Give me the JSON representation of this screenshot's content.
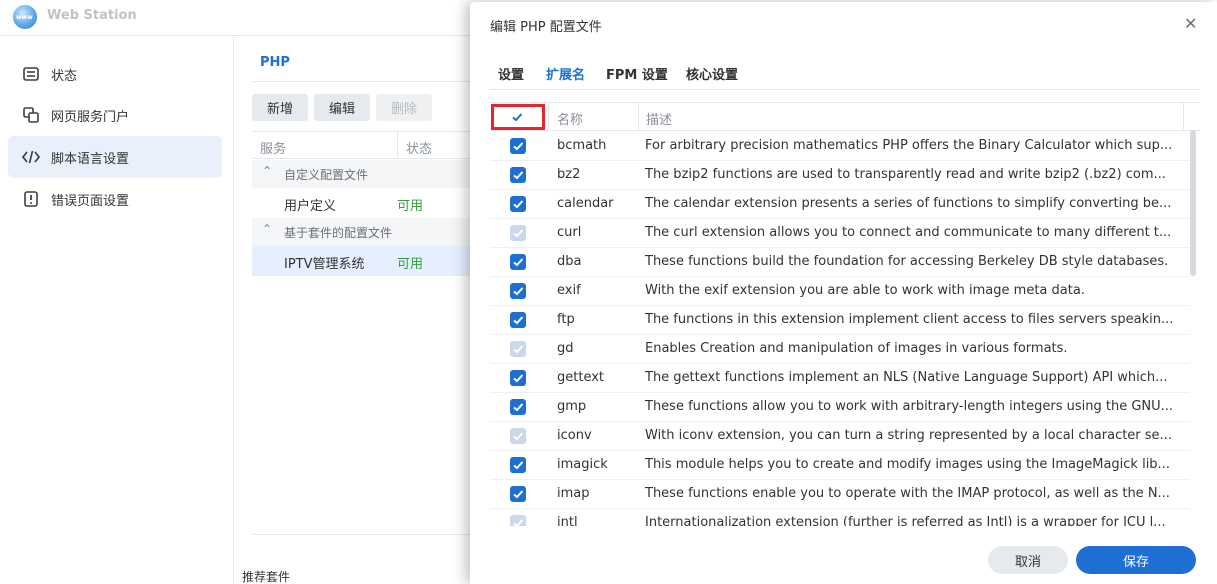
{
  "app": {
    "title": "Web Station",
    "logo_text": "www"
  },
  "sidebar": {
    "items": [
      {
        "label": "状态",
        "icon": "list-icon"
      },
      {
        "label": "网页服务门户",
        "icon": "portal-icon"
      },
      {
        "label": "脚本语言设置",
        "icon": "code-icon"
      },
      {
        "label": "错误页面设置",
        "icon": "error-page-icon"
      }
    ]
  },
  "content": {
    "tab": "PHP",
    "buttons": {
      "add": "新增",
      "edit": "编辑",
      "delete": "删除"
    },
    "columns": {
      "service": "服务",
      "status": "状态"
    },
    "groups": [
      {
        "label": "自定义配置文件",
        "rows": [
          {
            "name": "用户定义",
            "status": "可用"
          }
        ]
      },
      {
        "label": "基于套件的配置文件",
        "rows": [
          {
            "name": "IPTV管理系统",
            "status": "可用"
          }
        ]
      }
    ],
    "bottom_text": "推荐套件"
  },
  "modal": {
    "title": "编辑 PHP 配置文件",
    "tabs": [
      "设置",
      "扩展名",
      "FPM 设置",
      "核心设置"
    ],
    "active_tab": "扩展名",
    "columns": {
      "name": "名称",
      "description": "描述"
    },
    "extensions": [
      {
        "name": "bcmath",
        "desc": "For arbitrary precision mathematics PHP offers the Binary Calculator which sup...",
        "checked": true,
        "disabled": false
      },
      {
        "name": "bz2",
        "desc": "The bzip2 functions are used to transparently read and write bzip2 (.bz2) com...",
        "checked": true,
        "disabled": false
      },
      {
        "name": "calendar",
        "desc": "The calendar extension presents a series of functions to simplify converting be...",
        "checked": true,
        "disabled": false
      },
      {
        "name": "curl",
        "desc": "The curl extension allows you to connect and communicate to many different t...",
        "checked": true,
        "disabled": true
      },
      {
        "name": "dba",
        "desc": "These functions build the foundation for accessing Berkeley DB style databases.",
        "checked": true,
        "disabled": false
      },
      {
        "name": "exif",
        "desc": "With the exif extension you are able to work with image meta data.",
        "checked": true,
        "disabled": false
      },
      {
        "name": "ftp",
        "desc": "The functions in this extension implement client access to files servers speakin...",
        "checked": true,
        "disabled": false
      },
      {
        "name": "gd",
        "desc": "Enables Creation and manipulation of images in various formats.",
        "checked": true,
        "disabled": true
      },
      {
        "name": "gettext",
        "desc": "The gettext functions implement an NLS (Native Language Support) API which...",
        "checked": true,
        "disabled": false
      },
      {
        "name": "gmp",
        "desc": "These functions allow you to work with arbitrary-length integers using the GNU...",
        "checked": true,
        "disabled": false
      },
      {
        "name": "iconv",
        "desc": "With iconv extension, you can turn a string represented by a local character se...",
        "checked": true,
        "disabled": true
      },
      {
        "name": "imagick",
        "desc": "This module helps you to create and modify images using the ImageMagick lib...",
        "checked": true,
        "disabled": false
      },
      {
        "name": "imap",
        "desc": "These functions enable you to operate with the IMAP protocol, as well as the N...",
        "checked": true,
        "disabled": false
      },
      {
        "name": "intl",
        "desc": "Internationalization extension (further is referred as Intl) is a wrapper for ICU l...",
        "checked": true,
        "disabled": true
      }
    ],
    "buttons": {
      "cancel": "取消",
      "save": "保存"
    }
  },
  "colors": {
    "accent": "#1d6fd4",
    "highlight": "#e8252c",
    "available": "#2f9e3a"
  }
}
